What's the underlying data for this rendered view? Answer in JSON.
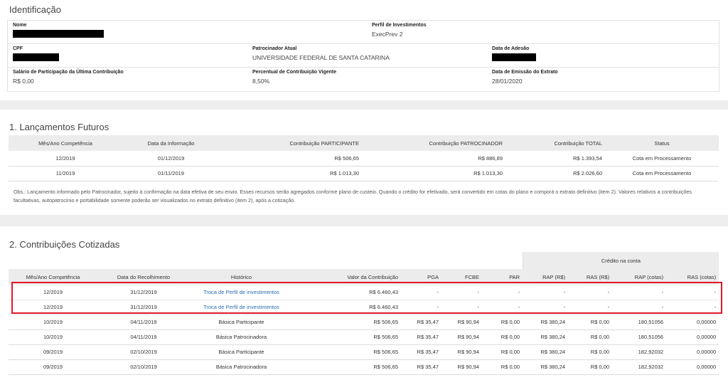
{
  "ident": {
    "title": "Identificação",
    "nome_label": "Nome",
    "perfil_label": "Perfil de Investimentos",
    "perfil_value": "ExecPrev 2",
    "cpf_label": "CPF",
    "patrocinador_label": "Patrocinador Atual",
    "patrocinador_value": "UNIVERSIDADE FEDERAL DE SANTA CATARINA",
    "adesao_label": "Data de Adesão",
    "salario_label": "Salário de Participação da Última Contribuição",
    "salario_value": "R$ 0,00",
    "percentual_label": "Percentual de Contribuição Vigente",
    "percentual_value": "8,50%",
    "emissao_label": "Data de Emissão do Extrato",
    "emissao_value": "28/01/2020"
  },
  "lanc": {
    "title": "1. Lançamentos Futuros",
    "headers": [
      "Mês/Ano Competência",
      "Data da Informação",
      "Contribuição PARTICIPANTE",
      "Contribuição PATROCINADOR",
      "Contribuição TOTAL",
      "Status"
    ],
    "rows": [
      [
        "12/2019",
        "01/12/2019",
        "R$ 506,65",
        "R$ 886,89",
        "R$ 1.393,54",
        "Cota em Processamento"
      ],
      [
        "11/2019",
        "01/11/2019",
        "R$ 1.013,30",
        "R$ 1.013,30",
        "R$ 2.026,60",
        "Cota em Processamento"
      ]
    ],
    "obs": "Obs.: Lançamento informado pelo Patrocinador, sujeito à confirmação na data efetiva de seu envio. Esses recursos serão agregados conforme plano de custeio. Quando o crédito for efetivado, será convertido em cotas do plano e comporá o extrato definitivo (item 2). Valores relativos a contribuições facultativas, autopatrocínio e portabilidade somente poderão ser visualizados no extrato definitivo (item 2), após a cotização."
  },
  "contrib": {
    "title": "2. Contribuições Cotizadas",
    "credit_header": "Crédito na conta",
    "headers": [
      "Mês/Ano Competência",
      "Data do Recolhimento",
      "Histórico",
      "Valor da Contribuição",
      "PGA",
      "FCBE",
      "PAR",
      "RAP (R$)",
      "RAS (R$)",
      "RAP (cotas)",
      "RAS (cotas)"
    ],
    "rows": [
      [
        "12/2019",
        "31/12/2019",
        "Troca de Perfil de investimentos",
        "R$ 6.460,43",
        "-",
        "-",
        "-",
        "-",
        "-",
        "-",
        "-"
      ],
      [
        "12/2019",
        "31/12/2019",
        "Troca de Perfil de investimentos",
        "R$ 6.460,43",
        "-",
        "-",
        "-",
        "-",
        "-",
        "-",
        "-"
      ],
      [
        "10/2019",
        "04/11/2019",
        "Básica Participante",
        "R$ 506,65",
        "R$ 35,47",
        "R$ 90,94",
        "R$ 0,00",
        "R$ 380,24",
        "R$ 0,00",
        "180,51056",
        "0,00000"
      ],
      [
        "10/2019",
        "04/11/2019",
        "Básica Patrocinadora",
        "R$ 506,65",
        "R$ 35,47",
        "R$ 90,94",
        "R$ 0,00",
        "R$ 380,24",
        "R$ 0,00",
        "180,51056",
        "0,00000"
      ],
      [
        "09/2019",
        "02/10/2019",
        "Básica Participante",
        "R$ 506,65",
        "R$ 35,47",
        "R$ 90,94",
        "R$ 0,00",
        "R$ 380,24",
        "R$ 0,00",
        "182,92032",
        "0,00000"
      ],
      [
        "09/2019",
        "02/10/2019",
        "Básica Patrocinadora",
        "R$ 506,65",
        "R$ 35,47",
        "R$ 90,94",
        "R$ 0,00",
        "R$ 380,24",
        "R$ 0,00",
        "182,92032",
        "0,00000"
      ]
    ]
  },
  "colors": {
    "link": "#2d6db5",
    "highlight": "#e0192a",
    "redaction": "#000000"
  }
}
